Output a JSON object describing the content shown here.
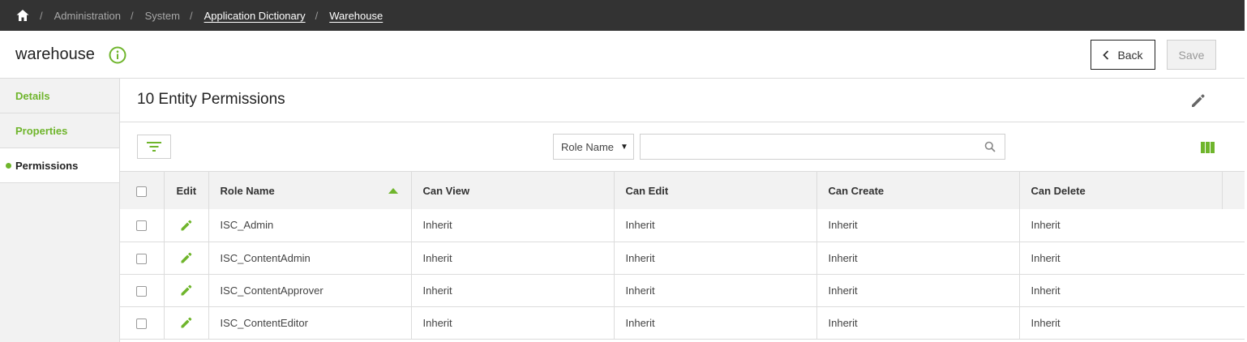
{
  "breadcrumb": {
    "items": [
      {
        "label": "Administration"
      },
      {
        "label": "System"
      },
      {
        "label": "Application Dictionary"
      },
      {
        "label": "Warehouse"
      }
    ],
    "separator": "/"
  },
  "header": {
    "title": "warehouse",
    "back_label": "Back",
    "save_label": "Save"
  },
  "sidebar": {
    "items": [
      {
        "label": "Details"
      },
      {
        "label": "Properties"
      },
      {
        "label": "Permissions"
      }
    ]
  },
  "main": {
    "title": "10 Entity Permissions",
    "search": {
      "field_select": "Role Name",
      "value": ""
    }
  },
  "table": {
    "columns": [
      "Edit",
      "Role Name",
      "Can View",
      "Can Edit",
      "Can Create",
      "Can Delete"
    ],
    "rows": [
      {
        "role": "ISC_Admin",
        "view": "Inherit",
        "edit": "Inherit",
        "create": "Inherit",
        "delete": "Inherit"
      },
      {
        "role": "ISC_ContentAdmin",
        "view": "Inherit",
        "edit": "Inherit",
        "create": "Inherit",
        "delete": "Inherit"
      },
      {
        "role": "ISC_ContentApprover",
        "view": "Inherit",
        "edit": "Inherit",
        "create": "Inherit",
        "delete": "Inherit"
      },
      {
        "role": "ISC_ContentEditor",
        "view": "Inherit",
        "edit": "Inherit",
        "create": "Inherit",
        "delete": "Inherit"
      }
    ]
  },
  "icons": {
    "home": "home-icon",
    "info": "info-icon",
    "back": "chevron-left-icon",
    "edit": "pencil-icon",
    "filter": "filter-icon",
    "search": "search-icon",
    "columns": "columns-icon"
  },
  "colors": {
    "accent": "#6fb52c",
    "topbar": "#333333",
    "sidebar_bg": "#f2f2f2"
  }
}
